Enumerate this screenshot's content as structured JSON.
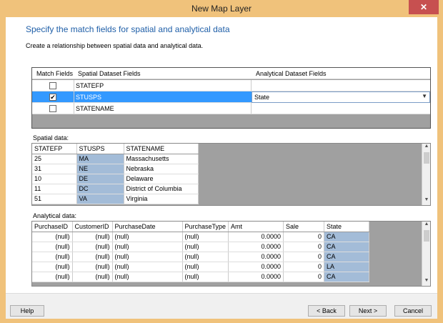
{
  "window": {
    "title": "New Map Layer",
    "close_glyph": "✕"
  },
  "page": {
    "heading": "Specify the match fields for spatial and analytical data",
    "description": "Create a relationship between spatial data and analytical data."
  },
  "match_grid": {
    "headers": [
      "Match Fields",
      "Spatial Dataset Fields",
      "Analytical Dataset Fields"
    ],
    "rows": [
      {
        "checked": false,
        "spatial": "STATEFP",
        "analytical": ""
      },
      {
        "checked": true,
        "spatial": "STUSPS",
        "analytical": "State"
      },
      {
        "checked": false,
        "spatial": "STATENAME",
        "analytical": ""
      }
    ]
  },
  "spatial_data": {
    "label": "Spatial data:",
    "columns": [
      "STATEFP",
      "STUSPS",
      "STATENAME"
    ],
    "rows": [
      [
        "25",
        "MA",
        "Massachusetts"
      ],
      [
        "31",
        "NE",
        "Nebraska"
      ],
      [
        "10",
        "DE",
        "Delaware"
      ],
      [
        "11",
        "DC",
        "District of Columbia"
      ],
      [
        "51",
        "VA",
        "Virginia"
      ]
    ]
  },
  "analytical_data": {
    "label": "Analytical data:",
    "columns": [
      "PurchaseID",
      "CustomerID",
      "PurchaseDate",
      "PurchaseType",
      "Amt",
      "Sale",
      "State"
    ],
    "rows": [
      [
        "(null)",
        "(null)",
        "(null)",
        "(null)",
        "0.0000",
        "0",
        "CA"
      ],
      [
        "(null)",
        "(null)",
        "(null)",
        "(null)",
        "0.0000",
        "0",
        "CA"
      ],
      [
        "(null)",
        "(null)",
        "(null)",
        "(null)",
        "0.0000",
        "0",
        "CA"
      ],
      [
        "(null)",
        "(null)",
        "(null)",
        "(null)",
        "0.0000",
        "0",
        "LA"
      ],
      [
        "(null)",
        "(null)",
        "(null)",
        "(null)",
        "0.0000",
        "0",
        "CA"
      ]
    ]
  },
  "buttons": {
    "help": "Help",
    "back": "< Back",
    "next": "Next >",
    "cancel": "Cancel"
  },
  "colors": {
    "title_bar": "#f0c27b",
    "selected_row": "#3399ff",
    "key_column": "#a3bcd8",
    "heading": "#1f5fa8"
  }
}
